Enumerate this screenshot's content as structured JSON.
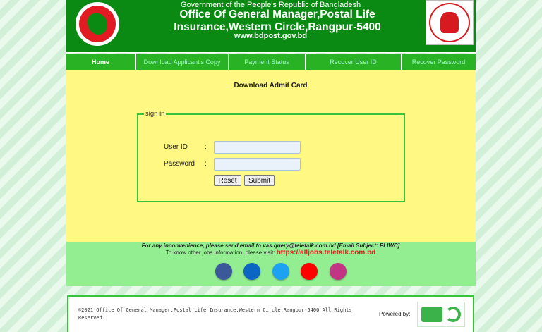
{
  "header": {
    "government": "Government of the People's Republic of Bangladesh",
    "office_line1": "Office Of General Manager,Postal Life",
    "office_line2": "Insurance,Western Circle,Rangpur-5400",
    "website": "www.bdpost.gov.bd"
  },
  "nav": {
    "items": [
      {
        "label": "Home"
      },
      {
        "label": "Download Applicant's Copy"
      },
      {
        "label": "Payment Status"
      },
      {
        "label": "Recover User ID"
      },
      {
        "label": "Recover Password"
      }
    ]
  },
  "main": {
    "title": "Download Admit Card",
    "form": {
      "legend": "sign in",
      "user_id_label": "User ID",
      "password_label": "Password",
      "separator": ":",
      "user_id_value": "",
      "password_value": "",
      "reset_label": "Reset",
      "submit_label": "Submit"
    }
  },
  "contact": {
    "email_note": "For any inconvenience, please send email to vas.query@teletalk.com.bd  [Email Subject: PLIWC]",
    "jobs_prefix": "To know other jobs information, please visit:",
    "jobs_url": "https://alljobs.teletalk.com.bd",
    "social": [
      {
        "icon": "facebook-icon",
        "color": "#3b5998"
      },
      {
        "icon": "linkedin-icon",
        "color": "#0a66c2"
      },
      {
        "icon": "twitter-icon",
        "color": "#1da1f2"
      },
      {
        "icon": "youtube-icon",
        "color": "#ff0000"
      },
      {
        "icon": "instagram-icon",
        "color": "#c13584"
      }
    ]
  },
  "footer": {
    "copyright": "©2021 Office Of General Manager,Postal Life Insurance,Western Circle,Rangpur-5400 All Rights Reserved.",
    "powered_by": "Powered by:"
  },
  "colors": {
    "header_green": "#0a8a12",
    "nav_green": "#29b324",
    "main_yellow": "#fff882",
    "contact_green": "#93ee91",
    "url_red": "#e0221f"
  }
}
